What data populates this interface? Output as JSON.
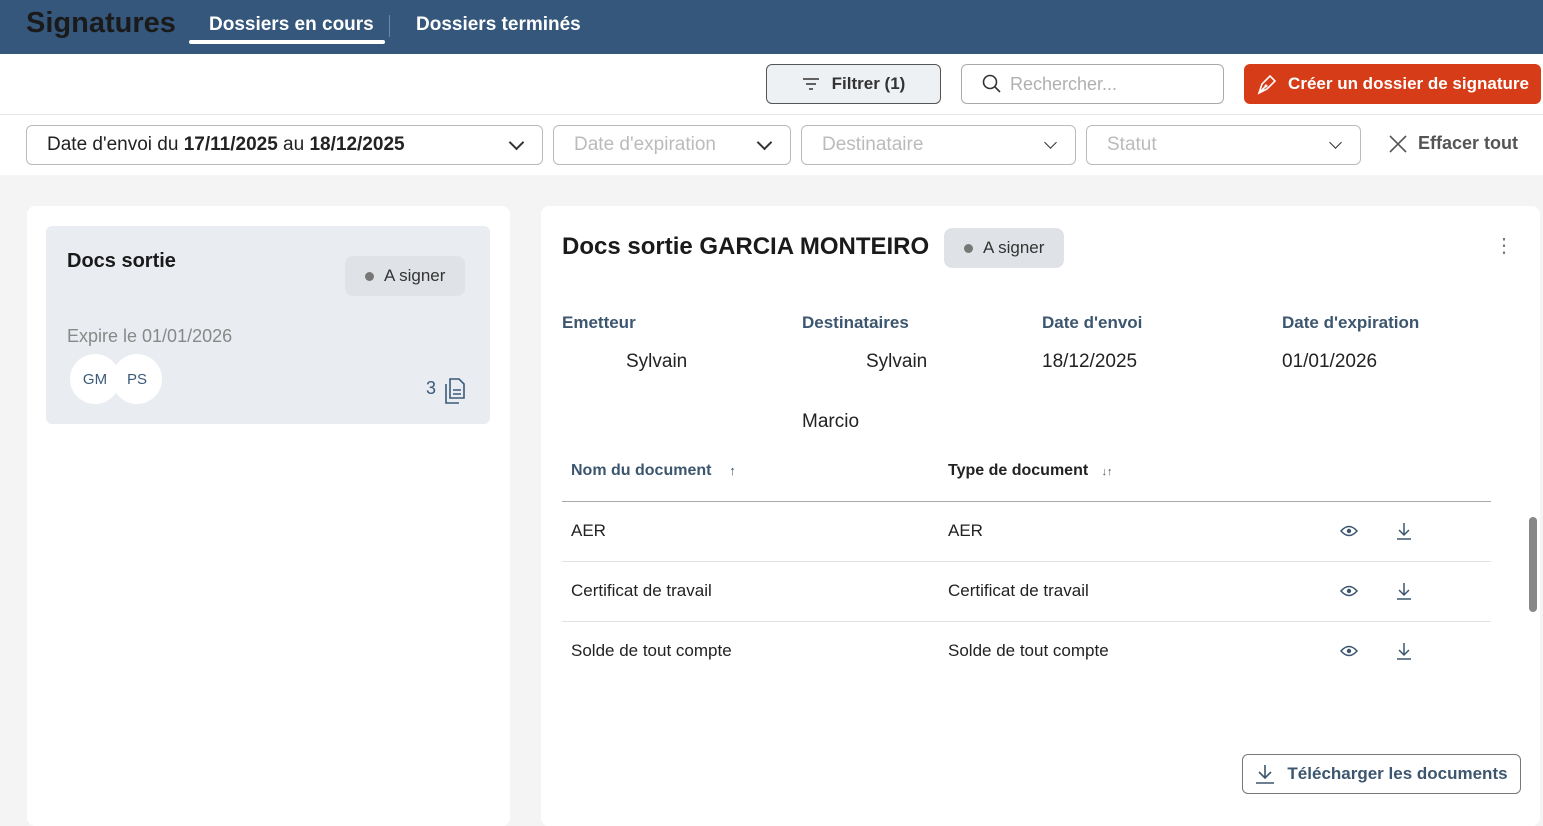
{
  "header": {
    "title": "Signatures",
    "tabs": [
      {
        "label": "Dossiers en cours",
        "active": true
      },
      {
        "label": "Dossiers terminés",
        "active": false
      }
    ]
  },
  "toolbar": {
    "filter_label": "Filtrer (1)",
    "search_placeholder": "Rechercher...",
    "create_label": "Créer un dossier de signature"
  },
  "filters": {
    "date_envoi_prefix": "Date d'envoi du ",
    "date_from": "17/11/2025",
    "date_mid": " au ",
    "date_to": "18/12/2025",
    "expiration": "Date d'expiration",
    "destinataire": "Destinataire",
    "statut": "Statut",
    "clear_all": "Effacer tout"
  },
  "list": {
    "cards": [
      {
        "title": "Docs sortie",
        "status": "A signer",
        "expires": "Expire le 01/01/2026",
        "avatars": [
          "GM",
          "PS"
        ],
        "doc_count": "3"
      }
    ]
  },
  "detail": {
    "title": "Docs sortie GARCIA MONTEIRO",
    "status": "A signer",
    "emetteur_label": "Emetteur",
    "emetteur": "Sylvain",
    "destinataires_label": "Destinataires",
    "destinataires": [
      "Sylvain",
      "Marcio"
    ],
    "date_envoi_label": "Date d'envoi",
    "date_envoi": "18/12/2025",
    "date_expiration_label": "Date d'expiration",
    "date_expiration": "01/01/2026",
    "table": {
      "columns": [
        "Nom du document",
        "Type de document"
      ],
      "sort_asc": "↑",
      "sort_both": "↓↑",
      "rows": [
        {
          "name": "AER",
          "type": "AER"
        },
        {
          "name": "Certificat de travail",
          "type": "Certificat de travail"
        },
        {
          "name": "Solde de tout compte",
          "type": "Solde de tout compte"
        }
      ]
    },
    "download_all": "Télécharger les documents"
  },
  "colors": {
    "header": "#35577b",
    "accent": "#d63c17"
  }
}
